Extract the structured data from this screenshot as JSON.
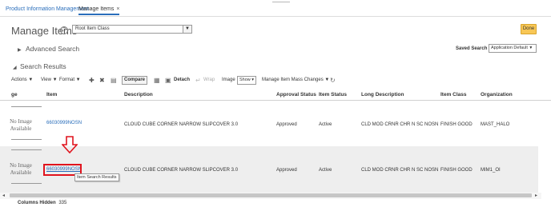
{
  "tabs": [
    {
      "label": "Product Information Management"
    },
    {
      "label": "Manage Items",
      "close": "×"
    }
  ],
  "header": {
    "title": "Manage Items",
    "help_icon": "question-circle-icon",
    "item_class_value": "Root Item Class",
    "done_label": "Done",
    "accent_color": "#f8c756"
  },
  "advanced_search": {
    "label": "Advanced Search",
    "saved_search_label": "Saved Search",
    "saved_search_value": "Application Default"
  },
  "search_results": {
    "label": "Search Results",
    "toolbar": {
      "actions": "Actions",
      "view": "View",
      "format": "Format",
      "compare": "Compare",
      "detach": "Detach",
      "wrap": "Wrap",
      "image_label": "Image",
      "image_value": "Show",
      "mass_changes": "Manage Item Mass Changes"
    },
    "columns": [
      "ge",
      "Item",
      "Description",
      "Approval Status",
      "Item Status",
      "Long Description",
      "Item Class",
      "Organization"
    ],
    "rows": [
      {
        "image_text_1": "No Image",
        "image_text_2": "Available",
        "item": "66030999NOSN",
        "description": "CLOUD CUBE CORNER NARROW SLIPCOVER 3.0",
        "approval_status": "Approved",
        "item_status": "Active",
        "long_description": "CLD MOD CRNR CHR N SC NOSN",
        "item_class": "FINISH GOOD",
        "organization": "MAST_HALO"
      },
      {
        "image_text_1": "No Image",
        "image_text_2": "Available",
        "item": "66030999NOSN",
        "description": "CLOUD CUBE CORNER NARROW SLIPCOVER 3.0",
        "approval_status": "Approved",
        "item_status": "Active",
        "long_description": "CLD MOD CRNR CHR N SC NOSN",
        "item_class": "FINISH GOOD",
        "organization": "MIM1_OI"
      }
    ],
    "tooltip": "Item Search Results",
    "columns_hidden_label": "Columns Hidden",
    "columns_hidden_count": "335"
  },
  "annotation": {
    "arrow_color": "#e0141e"
  }
}
